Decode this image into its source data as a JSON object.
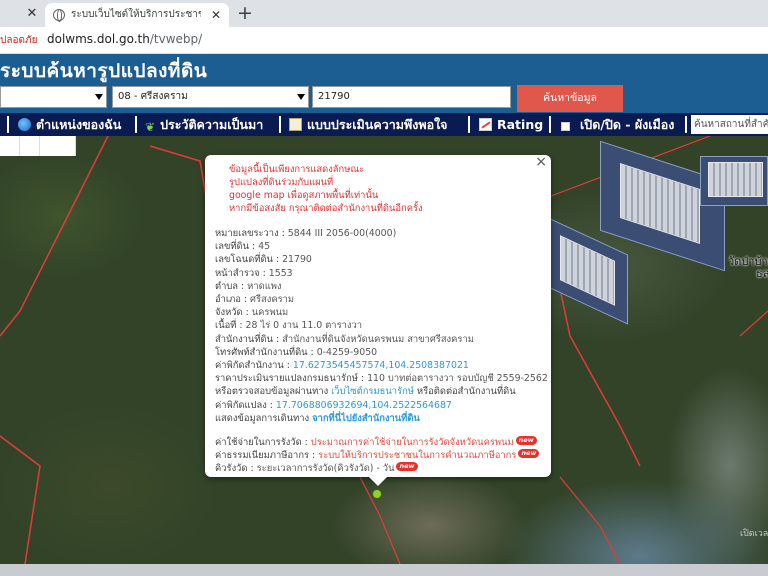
{
  "browser": {
    "tab_title": "ระบบเว็บไซต์ให้บริการประชาชน : กรมธนา...",
    "insecure_label": "ปลอดภัย",
    "url_host": "dolwms.dol.go.th",
    "url_path": "/tvwebp/"
  },
  "header": {
    "title": "ระบบค้นหารูปแปลงที่ดิน"
  },
  "search": {
    "province": "",
    "district": "08 - ศรีสงคราม",
    "parcel_number": "21790",
    "button_label": "ค้นหาข้อมูล"
  },
  "nav": {
    "my_location": "ตำแหน่งของฉัน",
    "history": "ประวัติความเป็นมา",
    "survey": "แบบประเมินความพึงพอใจ",
    "rating": "Rating",
    "toggle_city_plan": "เปิด/ปิด - ผังเมือง",
    "search_placeholder": "ค้นหาสถานที่สำคัญ"
  },
  "map": {
    "place_label": "วัดป่าบ้าน...",
    "place_label_2": "ธล",
    "corner_label": "เปิดเวลา"
  },
  "popup": {
    "notice_1": "ข้อมูลนี้เป็นเพียงการแสดงลักษณะ",
    "notice_2": "รูปแปลงที่ดินร่วมกับแผนที่",
    "notice_3a": "google map ",
    "notice_3b": "เพื่อดูสภาพพื้นที่เท่านั้น",
    "notice_4": "หากมีข้อสงสัย กรุณาติดต่อสำนักงานที่ดินอีกครั้ง",
    "map_sheet_label": "หมายเลขระวาง : ",
    "map_sheet": "5844 III 2056-00(4000)",
    "land_no_label": "เลขที่ดิน : ",
    "land_no": "45",
    "deed_no_label": "เลขโฉนดที่ดิน : ",
    "deed_no": "21790",
    "survey_page_label": "หน้าสำรวจ : ",
    "survey_page": "1553",
    "subdistrict_label": "ตำบล : ",
    "subdistrict": "หาดแพง",
    "district_label": "อำเภอ : ",
    "district": "ศรีสงคราม",
    "province_label": "จังหวัด : ",
    "province": "นครพนม",
    "area_label": "เนื้อที่ : ",
    "area": "28 ไร่ 0 งาน 11.0 ตารางวา",
    "land_office_label": "สำนักงานที่ดิน : ",
    "land_office": "สำนักงานที่ดินจังหวัดนครพนม สาขาศรีสงคราม",
    "office_phone_label": "โทรศัพท์สำนักงานที่ดิน : ",
    "office_phone": "0-4259-9050",
    "office_coord_label": "ค่าพิกัดสำนักงาน : ",
    "office_coord": "17.6273545457574,104.2508387021",
    "appraisal_label": "ราคาประเมินรายแปลงกรมธนารักษ์ : ",
    "appraisal": "110 บาทต่อตารางวา รอบบัญชี 2559-2562",
    "check_text_1": "หรือตรวจสอบข้อมูลผ่านทาง ",
    "check_link": "เว็บไซต์กรมธนารักษ์",
    "check_text_2": " หรือติดต่อสำนักงานที่ดิน",
    "parcel_coord_label": "ค่าพิกัดแปลง : ",
    "parcel_coord": "17.7068806932694,104.2522564687",
    "route_label": "แสดงข้อมูลการเดินทาง ",
    "route_link": "จากที่นี่ไปยังสำนักงานที่ดิน",
    "fee_label": "ค่าใช้จ่ายในการรังวัด : ",
    "fee_link": "ประมาณการค่าใช้จ่ายในการรังวัดจังหวัดนครพนม",
    "tax_label": "ค่าธรรมเนียมภาษีอากร : ",
    "tax_link": "ระบบให้บริการประชาชนในการคำนวณภาษีอากร",
    "queue_label": "คิวรังวัด : ",
    "queue_text": "ระยะเวลาการรังวัด(คิวรังวัด) - วัน",
    "badge": "new"
  }
}
